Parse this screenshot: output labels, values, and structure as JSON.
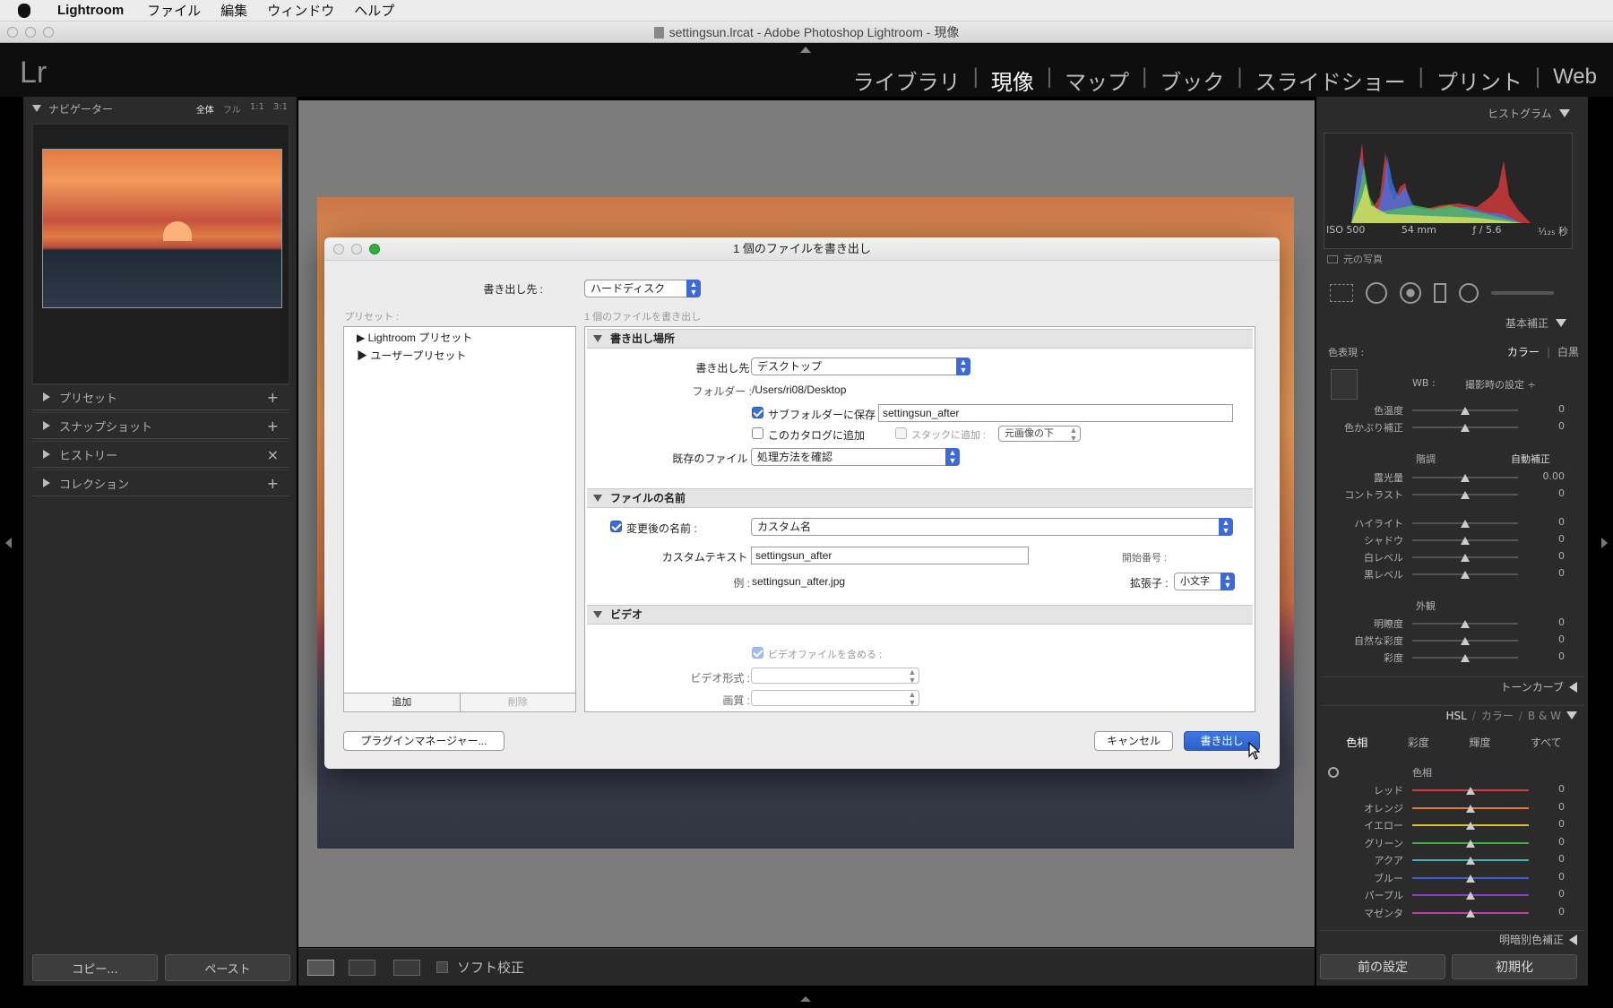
{
  "menubar": {
    "app": "Lightroom",
    "items": [
      "ファイル",
      "編集",
      "ウィンドウ",
      "ヘルプ"
    ]
  },
  "window": {
    "title": "settingsun.lrcat - Adobe Photoshop Lightroom - 現像"
  },
  "logo": "Lr",
  "modules": [
    "ライブラリ",
    "現像",
    "マップ",
    "ブック",
    "スライドショー",
    "プリント",
    "Web"
  ],
  "active_module": "現像",
  "left_panel": {
    "navigator": {
      "title": "ナビゲーター",
      "options": [
        "全体",
        "フル",
        "1:1",
        "3:1"
      ],
      "selected": "全体"
    },
    "sections": [
      {
        "label": "プリセット",
        "action": "+"
      },
      {
        "label": "スナップショット",
        "action": "+"
      },
      {
        "label": "ヒストリー",
        "action": "×"
      },
      {
        "label": "コレクション",
        "action": "+"
      }
    ],
    "copy_button": "コピー...",
    "paste_button": "ペースト"
  },
  "toolbar": {
    "soft_proof": "ソフト校正"
  },
  "right_panel": {
    "histogram_title": "ヒストグラム",
    "exif": {
      "iso": "ISO 500",
      "focal": "54 mm",
      "aperture": "ƒ / 5.6",
      "shutter": "¹⁄₁₂₅ 秒"
    },
    "original_photo": "元の写真",
    "basic_title": "基本補正",
    "treatment_label": "色表現 :",
    "treatment_color": "カラー",
    "treatment_bw": "白黒",
    "wb_label": "WB :",
    "wb_value": "撮影時の設定 ÷",
    "wb_sliders": [
      {
        "label": "色温度",
        "value": "0"
      },
      {
        "label": "色かぶり補正",
        "value": "0"
      }
    ],
    "tone_label": "階調",
    "auto_button": "自動補正",
    "tone_sliders": [
      {
        "label": "露光量",
        "value": "0.00"
      },
      {
        "label": "コントラスト",
        "value": "0"
      },
      {
        "label": "ハイライト",
        "value": "0"
      },
      {
        "label": "シャドウ",
        "value": "0"
      },
      {
        "label": "白レベル",
        "value": "0"
      },
      {
        "label": "黒レベル",
        "value": "0"
      }
    ],
    "presence_label": "外観",
    "presence_sliders": [
      {
        "label": "明瞭度",
        "value": "0"
      },
      {
        "label": "自然な彩度",
        "value": "0"
      },
      {
        "label": "彩度",
        "value": "0"
      }
    ],
    "tone_curve_title": "トーンカーブ",
    "hsl_header": [
      "HSL",
      "/",
      "カラー",
      "/",
      "B & W"
    ],
    "hsl_tabs": [
      "色相",
      "彩度",
      "輝度",
      "すべて"
    ],
    "hue_label": "色相",
    "hue_sliders": [
      {
        "label": "レッド",
        "value": "0",
        "color": "#d04040"
      },
      {
        "label": "オレンジ",
        "value": "0",
        "color": "#e07a30"
      },
      {
        "label": "イエロー",
        "value": "0",
        "color": "#d8c030"
      },
      {
        "label": "グリーン",
        "value": "0",
        "color": "#40b040"
      },
      {
        "label": "アクア",
        "value": "0",
        "color": "#40b0b0"
      },
      {
        "label": "ブルー",
        "value": "0",
        "color": "#3a60d0"
      },
      {
        "label": "パープル",
        "value": "0",
        "color": "#8a40c0"
      },
      {
        "label": "マゼンタ",
        "value": "0",
        "color": "#c040a0"
      }
    ],
    "split_toning_title": "明暗別色補正",
    "prev_button": "前の設定",
    "reset_button": "初期化"
  },
  "dialog": {
    "title": "1 個のファイルを書き出し",
    "export_to_label": "書き出し先 :",
    "export_to_value": "ハードディスク",
    "preset_label": "プリセット :",
    "summary": "1 個のファイルを書き出し",
    "presets": [
      "Lightroom プリセット",
      "ユーザープリセット"
    ],
    "add_button": "追加",
    "remove_button": "削除",
    "plugin_button": "プラグインマネージャー...",
    "cancel_button": "キャンセル",
    "export_button": "書き出し",
    "location": {
      "title": "書き出し場所",
      "export_to_label": "書き出し先 :",
      "export_to_value": "デスクトップ",
      "folder_label": "フォルダー :",
      "folder_value": "/Users/ri08/Desktop",
      "subfolder_label": "サブフォルダーに保存 :",
      "subfolder_value": "settingsun_after",
      "add_catalog_label": "このカタログに追加",
      "stack_label": "スタックに追加 :",
      "stack_value": "元画像の下",
      "existing_label": "既存のファイル :",
      "existing_value": "処理方法を確認"
    },
    "naming": {
      "title": "ファイルの名前",
      "rename_label": "変更後の名前 :",
      "rename_value": "カスタム名",
      "custom_text_label": "カスタムテキスト :",
      "custom_text_value": "settingsun_after",
      "start_number_label": "開始番号 :",
      "example_label": "例 :",
      "example_value": "settingsun_after.jpg",
      "extension_label": "拡張子 :",
      "extension_value": "小文字"
    },
    "video": {
      "title": "ビデオ",
      "include_label": "ビデオファイルを含める :",
      "format_label": "ビデオ形式 :",
      "quality_label": "画質 :"
    }
  }
}
